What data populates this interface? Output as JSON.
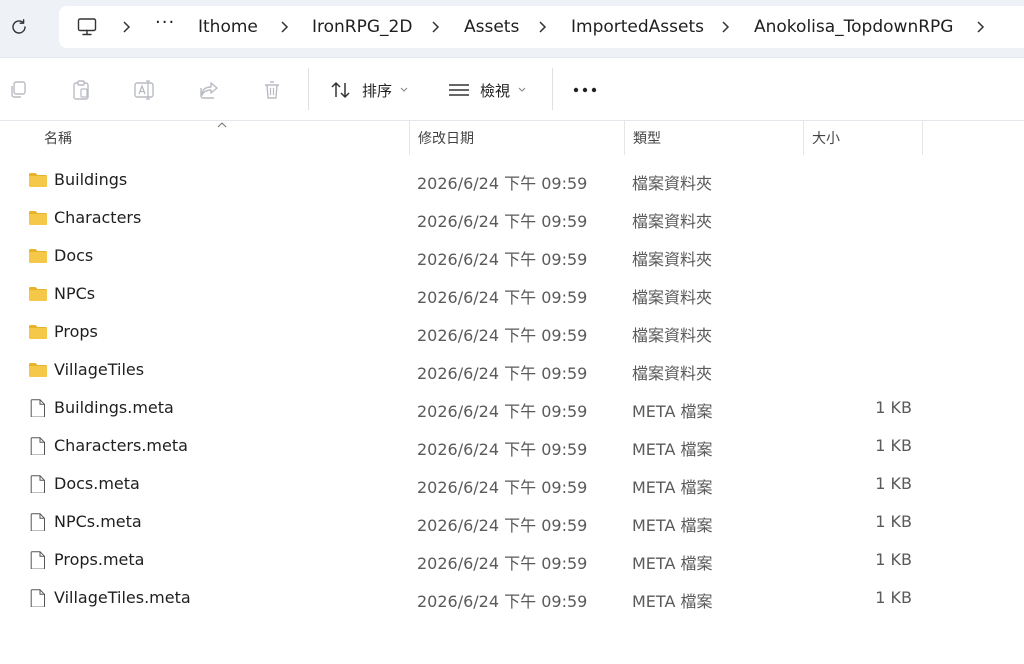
{
  "breadcrumb": {
    "items": [
      "Ithome",
      "IronRPG_2D",
      "Assets",
      "ImportedAssets",
      "Anokolisa_TopdownRPG"
    ],
    "overflow_label": "···"
  },
  "toolbar": {
    "sort_label": "排序",
    "view_label": "檢視"
  },
  "columns": {
    "name": "名稱",
    "date": "修改日期",
    "type": "類型",
    "size": "大小"
  },
  "files": [
    {
      "name": "Buildings",
      "kind": "folder",
      "date": "2026/6/24 下午 09:59",
      "type": "檔案資料夾",
      "size": ""
    },
    {
      "name": "Characters",
      "kind": "folder",
      "date": "2026/6/24 下午 09:59",
      "type": "檔案資料夾",
      "size": ""
    },
    {
      "name": "Docs",
      "kind": "folder",
      "date": "2026/6/24 下午 09:59",
      "type": "檔案資料夾",
      "size": ""
    },
    {
      "name": "NPCs",
      "kind": "folder",
      "date": "2026/6/24 下午 09:59",
      "type": "檔案資料夾",
      "size": ""
    },
    {
      "name": "Props",
      "kind": "folder",
      "date": "2026/6/24 下午 09:59",
      "type": "檔案資料夾",
      "size": ""
    },
    {
      "name": "VillageTiles",
      "kind": "folder",
      "date": "2026/6/24 下午 09:59",
      "type": "檔案資料夾",
      "size": ""
    },
    {
      "name": "Buildings.meta",
      "kind": "file",
      "date": "2026/6/24 下午 09:59",
      "type": "META 檔案",
      "size": "1 KB"
    },
    {
      "name": "Characters.meta",
      "kind": "file",
      "date": "2026/6/24 下午 09:59",
      "type": "META 檔案",
      "size": "1 KB"
    },
    {
      "name": "Docs.meta",
      "kind": "file",
      "date": "2026/6/24 下午 09:59",
      "type": "META 檔案",
      "size": "1 KB"
    },
    {
      "name": "NPCs.meta",
      "kind": "file",
      "date": "2026/6/24 下午 09:59",
      "type": "META 檔案",
      "size": "1 KB"
    },
    {
      "name": "Props.meta",
      "kind": "file",
      "date": "2026/6/24 下午 09:59",
      "type": "META 檔案",
      "size": "1 KB"
    },
    {
      "name": "VillageTiles.meta",
      "kind": "file",
      "date": "2026/6/24 下午 09:59",
      "type": "META 檔案",
      "size": "1 KB"
    }
  ],
  "colors": {
    "folder": "#f6c84a",
    "folder_dark": "#e8b22c",
    "address_bg": "#eef1f6"
  }
}
